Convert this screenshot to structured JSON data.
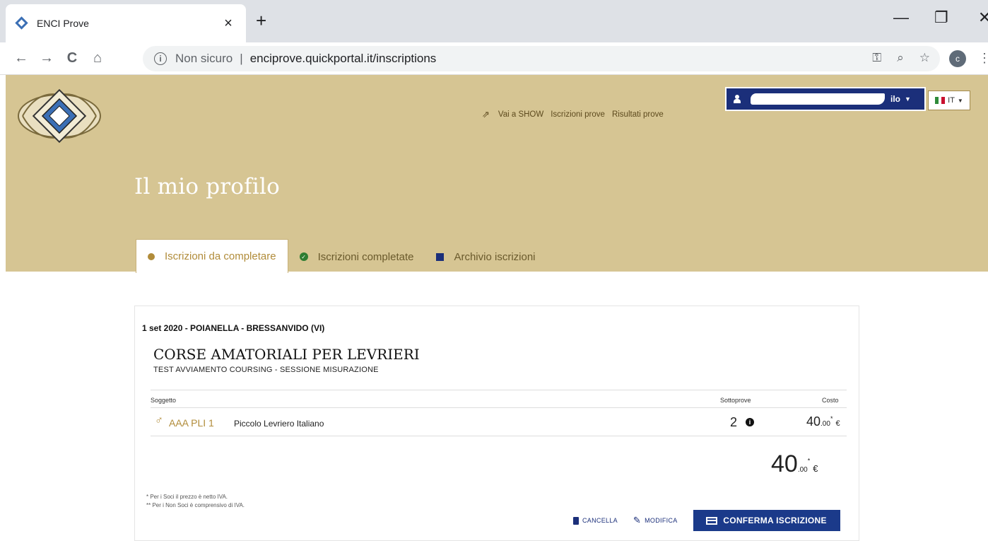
{
  "browser": {
    "tab_title": "ENCI Prove",
    "tab_close": "×",
    "new_tab": "+",
    "back": "←",
    "forward": "→",
    "reload": "C",
    "home": "⌂",
    "info": "i",
    "not_secure": "Non sicuro",
    "separator": "|",
    "url": "enciprove.quickportal.it/inscriptions",
    "key_icon": "⚿",
    "zoom_icon": "⌕",
    "star_icon": "☆",
    "profile_initial": "c",
    "menu_icon": "⋮",
    "minimize": "—",
    "maximize": "❐",
    "close": "✕"
  },
  "header": {
    "nav": {
      "show": "Vai a SHOW",
      "iscrizioni": "Iscrizioni prove",
      "risultati": "Risultati prove"
    },
    "user_suffix": "ilo",
    "lang": "IT",
    "page_title": "Il mio profilo",
    "tabs": [
      {
        "label": "Iscrizioni da completare",
        "active": true
      },
      {
        "label": "Iscrizioni completate",
        "active": false
      },
      {
        "label": "Archivio iscrizioni",
        "active": false
      }
    ]
  },
  "inscription": {
    "date_place": "1 set 2020 - POIANELLA - BRESSANVIDO (VI)",
    "title": "CORSE AMATORIALI PER LEVRIERI",
    "subtitle": "TEST AVVIAMENTO COURSING - SESSIONE MISURAZIONE",
    "columns": {
      "subject": "Soggetto",
      "subtests": "Sottoprove",
      "cost": "Costo"
    },
    "row": {
      "sex_symbol": "♂",
      "dog_name": "AAA PLI 1",
      "breed": "Piccolo Levriero Italiano",
      "subtests": "2",
      "info": "i",
      "cost_int": "40",
      "cost_dec": ".00",
      "cost_mark": "*",
      "currency": "€"
    },
    "total": {
      "int": "40",
      "dec": ".00",
      "mark": "*",
      "currency": "€"
    },
    "notes": [
      "* Per i Soci il prezzo è netto IVA.",
      "** Per i Non Soci è comprensivo di IVA."
    ],
    "actions": {
      "cancel": "CANCELLA",
      "modify": "MODIFICA",
      "confirm": "CONFERMA ISCRIZIONE"
    }
  },
  "colors": {
    "header_bg": "#d6c593",
    "accent_gold": "#b18c3a",
    "primary_blue": "#1b3a8a"
  }
}
